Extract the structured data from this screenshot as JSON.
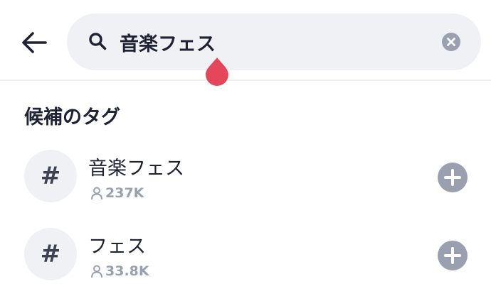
{
  "search": {
    "query": "音楽フェス"
  },
  "section": {
    "title": "候補のタグ"
  },
  "tags": [
    {
      "symbol": "#",
      "name": "音楽フェス",
      "count": "237K"
    },
    {
      "symbol": "#",
      "name": "フェス",
      "count": "33.8K"
    }
  ],
  "colors": {
    "text": "#1f2235",
    "muted": "#9aa0af",
    "search_bg": "#f0f1f5",
    "cursor_handle": "#e5475a"
  },
  "icons": {
    "back": "arrow-left-icon",
    "search": "search-icon",
    "clear": "clear-icon",
    "user": "user-icon",
    "add": "plus-circle-icon"
  }
}
